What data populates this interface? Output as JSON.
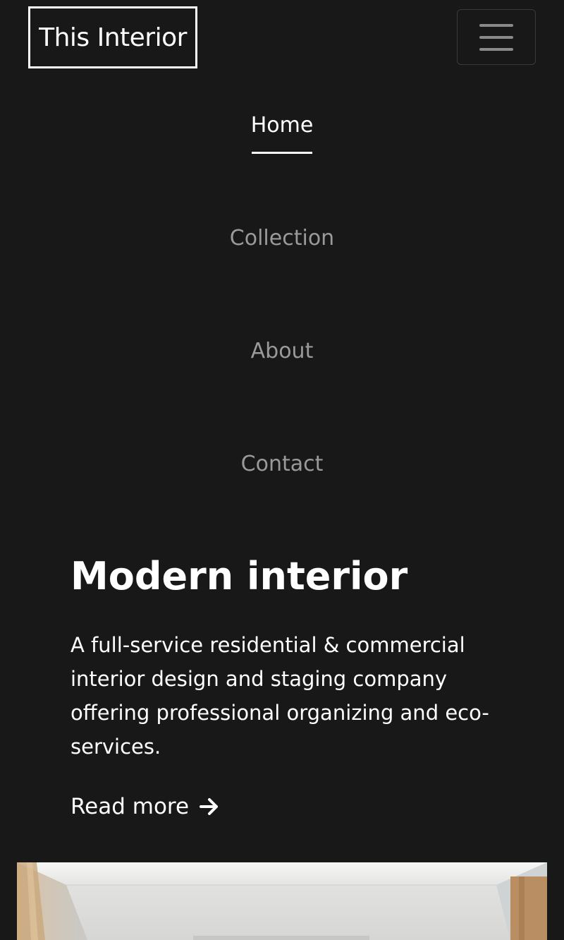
{
  "header": {
    "brand": "This Interior",
    "menu_toggle_icon": "hamburger-menu-icon"
  },
  "nav": {
    "items": [
      {
        "label": "Home",
        "active": true
      },
      {
        "label": "Collection",
        "active": false
      },
      {
        "label": "About",
        "active": false
      },
      {
        "label": "Contact",
        "active": false
      }
    ]
  },
  "hero": {
    "title": "Modern interior",
    "description": "A full-service residential & commercial interior design and staging company offering professional organizing and eco-services.",
    "read_more": "Read more",
    "read_more_icon": "arrow-right-icon"
  },
  "colors": {
    "background": "#181818",
    "text": "#ffffff",
    "nav_inactive": "#9a9a9a"
  }
}
